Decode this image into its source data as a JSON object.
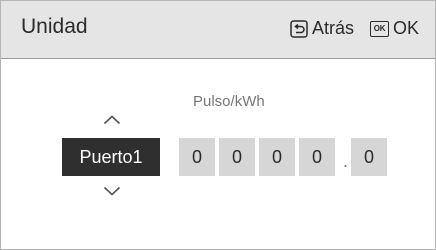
{
  "header": {
    "title": "Unidad",
    "back_label": "Atrás",
    "ok_label": "OK",
    "ok_icon_text": "OK"
  },
  "field": {
    "unit_label": "Pulso/kWh",
    "port_value": "Puerto1",
    "digits": [
      "0",
      "0",
      "0",
      "0"
    ],
    "decimal_separator": ".",
    "decimal_digit": "0"
  },
  "icons": {
    "back": "return-arrow-icon",
    "ok": "ok-key-icon",
    "up": "chevron-up-icon",
    "down": "chevron-down-icon"
  },
  "colors": {
    "header_bg": "#e5e5e5",
    "selected_bg": "#2f2f2f",
    "digit_bg": "#d6d6d6",
    "muted_text": "#777777"
  }
}
